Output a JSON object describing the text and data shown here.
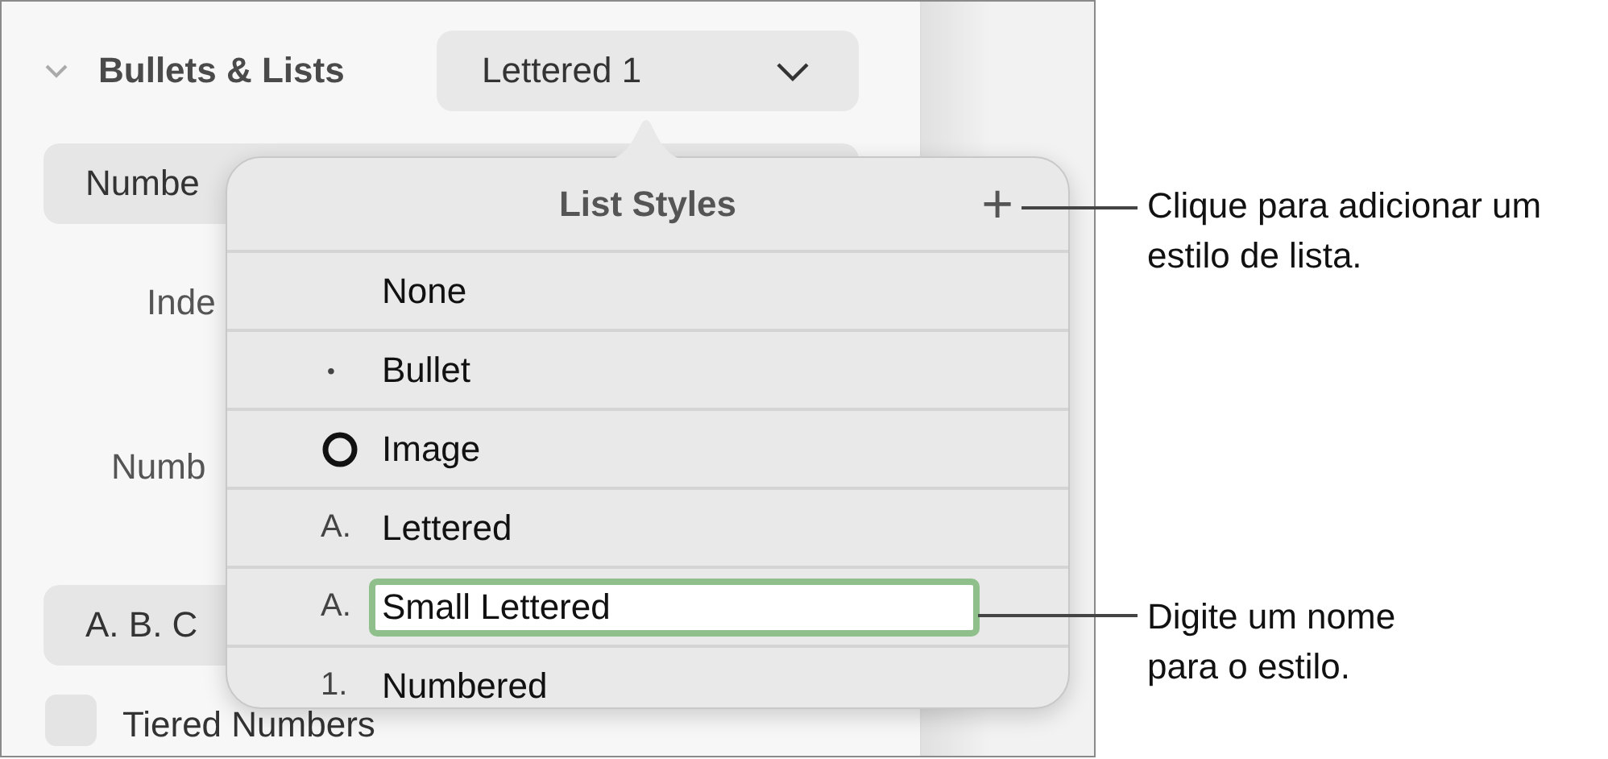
{
  "panel": {
    "section_title": "Bullets & Lists",
    "style_dropdown": "Lettered 1",
    "preset_button": "Numbe",
    "indent_label": "Inde",
    "number_label": "Numb",
    "format_button": "A. B. C",
    "tiered_checkbox": {
      "label": "Tiered Numbers",
      "checked": false
    }
  },
  "list_styles": {
    "title": "List Styles",
    "add_button": "+",
    "items": [
      {
        "kind": "plain",
        "label": "None"
      },
      {
        "kind": "marker",
        "marker": "•",
        "label": "Bullet"
      },
      {
        "kind": "image",
        "label": "Image"
      },
      {
        "kind": "marker",
        "marker": "A.",
        "label": "Lettered"
      },
      {
        "kind": "field",
        "marker": "A.",
        "label": "Small Lettered"
      },
      {
        "kind": "marker",
        "marker": "1.",
        "label": "Numbered"
      }
    ]
  },
  "callouts": [
    "Clique para adicionar um estilo de lista.",
    "Digite um nome para o estilo."
  ]
}
